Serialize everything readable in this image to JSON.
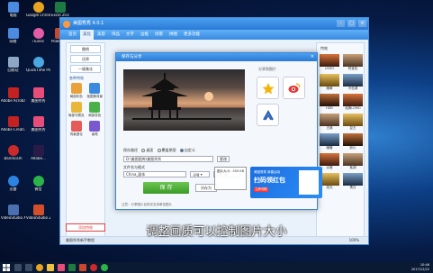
{
  "desktop_icons": [
    {
      "label": "电脑",
      "color": "#4b8be0"
    },
    {
      "label": "Google Chrome",
      "color": "#e8a320"
    },
    {
      "label": "Excel 2016",
      "color": "#1e7a43"
    },
    {
      "label": "网络",
      "color": "#4b8be0"
    },
    {
      "label": "iTunes",
      "color": "#e25da5"
    },
    {
      "label": "PowerPoint 2016",
      "color": "#c9472a"
    },
    {
      "label": "回收站",
      "color": "#8fa7c4"
    },
    {
      "label": "QuickTime Player",
      "color": "#4aa7e0"
    },
    {
      "label": "Adobe Acrobat DC",
      "color": "#c42121"
    },
    {
      "label": "美图秀秀",
      "color": "#e84d7a"
    },
    {
      "label": "Adobe Creati...",
      "color": "#c42121"
    },
    {
      "label": "美图秀秀",
      "color": "#e84d7a"
    },
    {
      "label": "Bandicam",
      "color": "#cc2a2a"
    },
    {
      "label": "Adobe...",
      "color": "#2a1a4a"
    },
    {
      "label": "迅雷",
      "color": "#2b84e0"
    },
    {
      "label": "微信",
      "color": "#2bb44a"
    },
    {
      "label": "VideoStudio X Training",
      "color": "#4b6fb0"
    },
    {
      "label": "VideoStudio 2018",
      "color": "#d24f2a"
    }
  ],
  "app": {
    "title": "美图秀秀 4.0.1",
    "tabs": [
      "首页",
      "美化",
      "美容",
      "饰品",
      "文字",
      "边框",
      "场景",
      "拼图",
      "更多功能"
    ],
    "left_buttons": [
      "撤销",
      "还原",
      "一键美化"
    ],
    "left_header": "各种特效",
    "left_tools": [
      {
        "label": "局部彩色",
        "color": "#e9a23a"
      },
      {
        "label": "抠图换背景",
        "color": "#3a8ae0"
      },
      {
        "label": "局部马赛克",
        "color": "#e8b73a"
      },
      {
        "label": "局部变色",
        "color": "#49b04a"
      },
      {
        "label": "背景虚化",
        "color": "#e65a5a"
      },
      {
        "label": "画笔",
        "color": "#7a59d0"
      }
    ],
    "add_library": "添加特效",
    "right_title": "特效",
    "thumbs": [
      "LOMO",
      "阿宝色",
      "暖黄",
      "冷色调",
      "HDR",
      "经典LOMO",
      "古典",
      "复古",
      "暖暖",
      "胶片",
      "淡雅",
      "紫调",
      "炫光",
      "黑白"
    ],
    "status_left": "美图秀秀新手教程",
    "status_zoom": "100%"
  },
  "dialog": {
    "title": "保存与分享",
    "share_title": "分享到图片",
    "save_path_label": "保存路径",
    "radio_options": [
      "桌面",
      "覆盖原图",
      "自定义"
    ],
    "path_value": "D:\\美图图库\\美图秀秀",
    "browse_label": "更改",
    "filename_label": "文件名与格式",
    "filename_value": "China_副本",
    "format_value": ".jpg",
    "quality_value": "100",
    "save_button": "保 存",
    "other_button": "另存为",
    "tip": "注意：分享图片目前仅支持单张图片"
  },
  "tooltip": {
    "text": "图片大小：555 KB"
  },
  "ad": {
    "line1": "美图秀秀 新春活动",
    "line2": "扫码领红包",
    "line3": "立即领取"
  },
  "subtitle": "调整画质可以控制图片大小",
  "taskbar": {
    "time": "10:46",
    "date": "2017/12/22"
  }
}
